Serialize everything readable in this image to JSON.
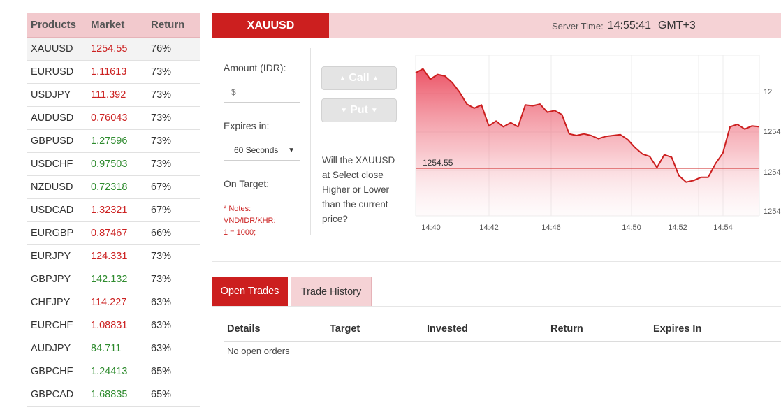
{
  "products": {
    "headers": {
      "product": "Products",
      "market": "Market",
      "return": "Return"
    },
    "rows": [
      {
        "symbol": "XAUUSD",
        "market": "1254.55",
        "ret": "76%",
        "dir": "down"
      },
      {
        "symbol": "EURUSD",
        "market": "1.11613",
        "ret": "73%",
        "dir": "down"
      },
      {
        "symbol": "USDJPY",
        "market": "111.392",
        "ret": "73%",
        "dir": "down"
      },
      {
        "symbol": "AUDUSD",
        "market": "0.76043",
        "ret": "73%",
        "dir": "down"
      },
      {
        "symbol": "GBPUSD",
        "market": "1.27596",
        "ret": "73%",
        "dir": "up"
      },
      {
        "symbol": "USDCHF",
        "market": "0.97503",
        "ret": "73%",
        "dir": "up"
      },
      {
        "symbol": "NZDUSD",
        "market": "0.72318",
        "ret": "67%",
        "dir": "up"
      },
      {
        "symbol": "USDCAD",
        "market": "1.32321",
        "ret": "67%",
        "dir": "down"
      },
      {
        "symbol": "EURGBP",
        "market": "0.87467",
        "ret": "66%",
        "dir": "down"
      },
      {
        "symbol": "EURJPY",
        "market": "124.331",
        "ret": "73%",
        "dir": "down"
      },
      {
        "symbol": "GBPJPY",
        "market": "142.132",
        "ret": "73%",
        "dir": "up"
      },
      {
        "symbol": "CHFJPY",
        "market": "114.227",
        "ret": "63%",
        "dir": "down"
      },
      {
        "symbol": "EURCHF",
        "market": "1.08831",
        "ret": "63%",
        "dir": "down"
      },
      {
        "symbol": "AUDJPY",
        "market": "84.711",
        "ret": "63%",
        "dir": "up"
      },
      {
        "symbol": "GBPCHF",
        "market": "1.24413",
        "ret": "65%",
        "dir": "up"
      },
      {
        "symbol": "GBPCAD",
        "market": "1.68835",
        "ret": "65%",
        "dir": "up"
      }
    ]
  },
  "panel": {
    "symbol": "XAUUSD",
    "server_time_label": "Server Time:",
    "server_time": "14:55:41",
    "timezone": "GMT+3"
  },
  "form": {
    "amount_label": "Amount (IDR):",
    "amount_placeholder": "$",
    "expires_label": "Expires in:",
    "expires_value": "60 Seconds",
    "on_target_label": "On Target:",
    "notes": [
      "* Notes:",
      "VND/IDR/KHR:",
      "1 = 1000;"
    ]
  },
  "buttons": {
    "call": "Call",
    "put": "Put"
  },
  "question": "Will the XAUUSD at Select close Higher or Lower than the current price?",
  "chart_data": {
    "type": "area",
    "current_price": 1254.55,
    "current_price_label": "1254.55",
    "x_ticks": [
      "14:40",
      "14:42",
      "14:46",
      "14:50",
      "14:52",
      "14:54"
    ],
    "y_ticks": [
      "12",
      "1254.",
      "1254",
      "1254."
    ],
    "series": [
      {
        "values": [
          0.11,
          0.085,
          0.15,
          0.12,
          0.13,
          0.17,
          0.23,
          0.305,
          0.33,
          0.31,
          0.44,
          0.41,
          0.445,
          0.42,
          0.445,
          0.31,
          0.315,
          0.305,
          0.355,
          0.345,
          0.37,
          0.49,
          0.5,
          0.49,
          0.5,
          0.52,
          0.505,
          0.5,
          0.495,
          0.525,
          0.575,
          0.615,
          0.63,
          0.7,
          0.62,
          0.635,
          0.75,
          0.79,
          0.78,
          0.76,
          0.76,
          0.675,
          0.61,
          0.445,
          0.43,
          0.46,
          0.44,
          0.445
        ],
        "color": "#cc1f1f"
      }
    ],
    "grid": true
  },
  "trades": {
    "tabs": {
      "open": "Open Trades",
      "history": "Trade History"
    },
    "columns": [
      "Details",
      "Target",
      "Invested",
      "Return",
      "Expires In"
    ],
    "empty_text": "No open orders"
  },
  "colors": {
    "accent": "#cc1f1f",
    "accent_light": "#f5d2d5",
    "up": "#2e8b2e",
    "down": "#cc2222"
  }
}
